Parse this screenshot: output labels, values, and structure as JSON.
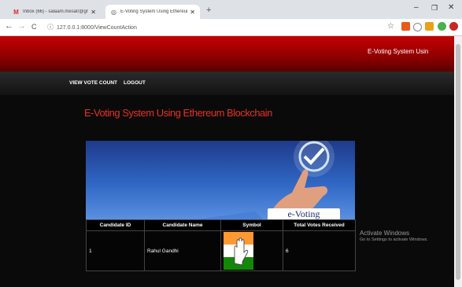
{
  "browser": {
    "tabs": [
      {
        "title": "Inbox (66) - salaam.mesa0@gmai",
        "icon": "gmail-icon"
      },
      {
        "title": "E-Voting System Using Ethereum",
        "icon": "globe-icon"
      }
    ],
    "new_tab": "+",
    "url": "127.0.0.1:8000/ViewCountAction",
    "nav": {
      "back": "←",
      "forward": "→",
      "reload": "C"
    },
    "window_controls": {
      "minimize": "–",
      "maximize": "❐",
      "close": "✕"
    },
    "bookmark_star": "☆"
  },
  "banner": {
    "brand": "E-Voting System Usin"
  },
  "menu": {
    "view_vote_count": "VIEW VOTE COUNT",
    "logout": "LOGOUT"
  },
  "page_title": "E-Voting System Using Ethereum Blockchain",
  "hero": {
    "text": "e-Voting"
  },
  "table": {
    "headers": [
      "Candidate ID",
      "Candidate Name",
      "Symbol",
      "Total Votes Received"
    ],
    "rows": [
      {
        "id": "1",
        "name": "Rahul Gandhi",
        "symbol": "hand-flag-icon",
        "votes": "6"
      }
    ]
  },
  "watermark": {
    "line1": "Activate Windows",
    "line2": "Go to Settings to activate Windows."
  },
  "colors": {
    "banner": "#c50000",
    "title": "#e53028",
    "hero": "#2f67c4"
  }
}
